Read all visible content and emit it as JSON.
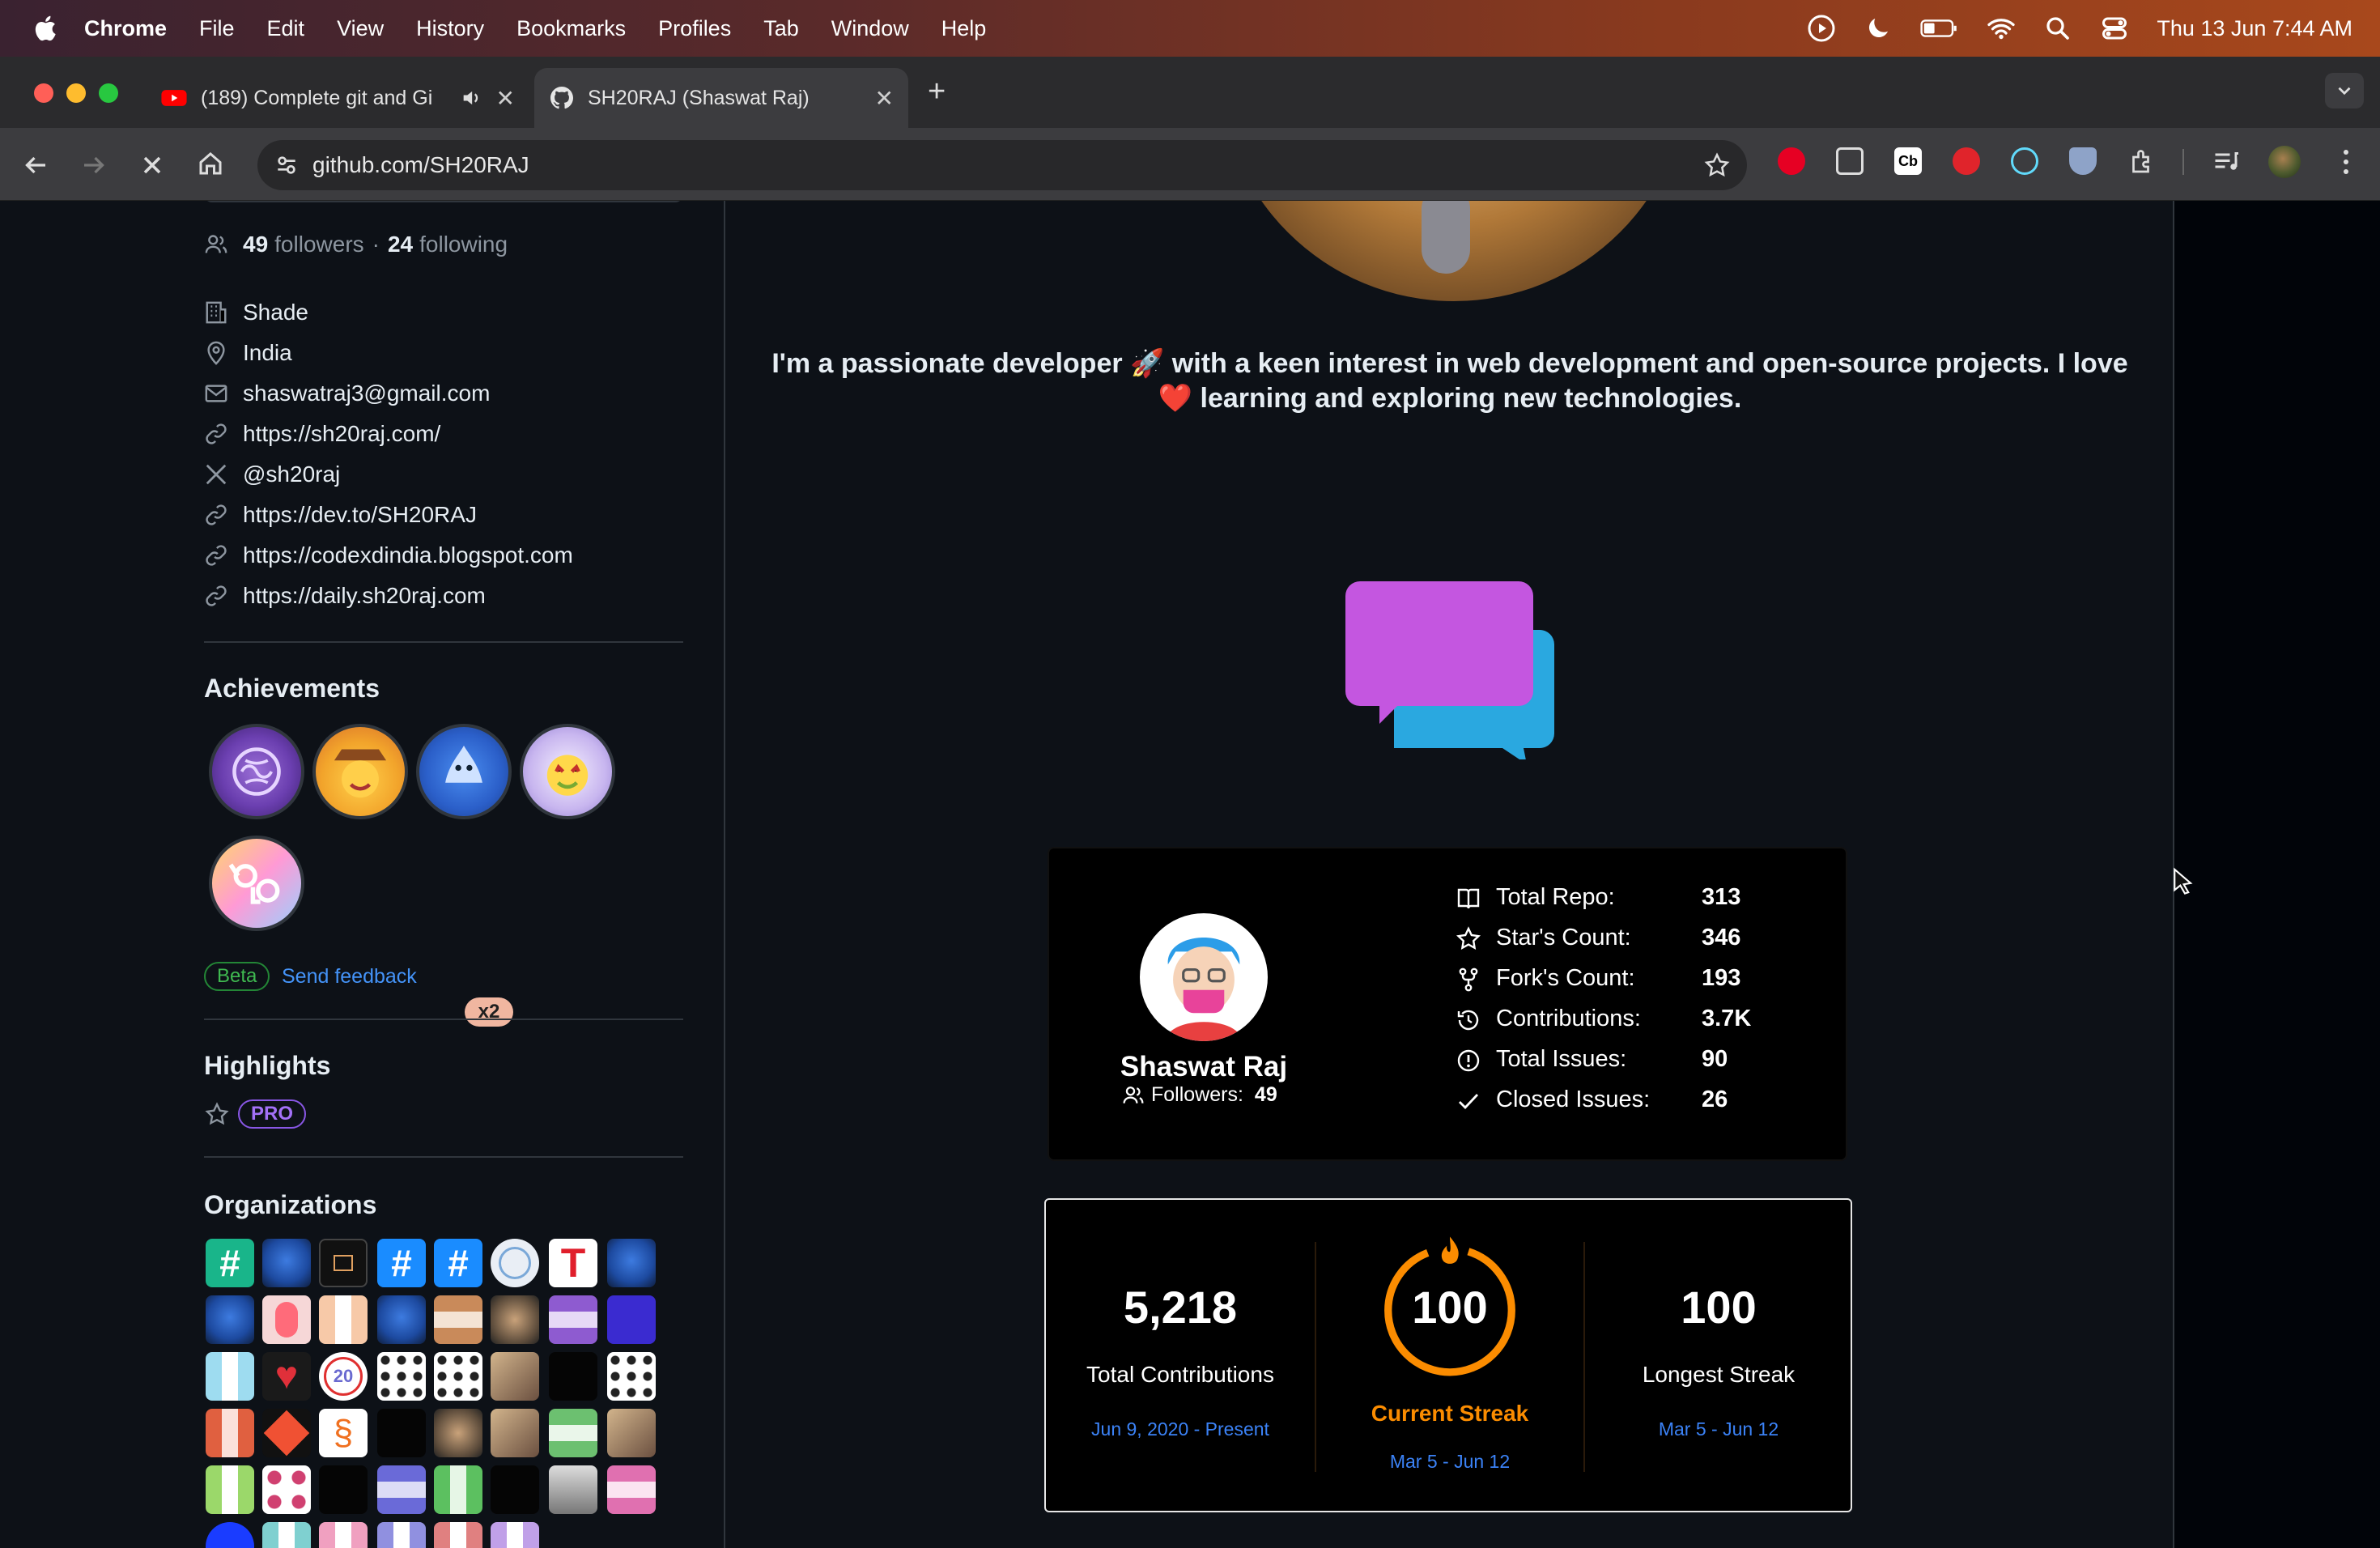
{
  "os_menubar": {
    "app_name": "Chrome",
    "menus": [
      "File",
      "Edit",
      "View",
      "History",
      "Bookmarks",
      "Profiles",
      "Tab",
      "Window",
      "Help"
    ],
    "clock": "Thu 13 Jun  7:44 AM"
  },
  "browser": {
    "tabs": [
      {
        "title": "(189) Complete git and Gi",
        "icon": "youtube-icon"
      },
      {
        "title": "SH20RAJ (Shaswat Raj)",
        "icon": "github-icon"
      }
    ],
    "url": "github.com/SH20RAJ"
  },
  "profile": {
    "followers_count": "49",
    "followers_label": "followers",
    "separator": "·",
    "following_count": "24",
    "following_label": "following",
    "company": "Shade",
    "location": "India",
    "email": "shaswatraj3@gmail.com",
    "website": "https://sh20raj.com/",
    "twitter": "@sh20raj",
    "links": [
      "https://dev.to/SH20RAJ",
      "https://codexdindia.blogspot.com",
      "https://daily.sh20raj.com"
    ],
    "achievements_title": "Achievements",
    "achievement_multiplier": "x2",
    "beta_label": "Beta",
    "feedback_label": "Send feedback",
    "highlights_title": "Highlights",
    "pro_label": "PRO",
    "organizations_title": "Organizations"
  },
  "readme": {
    "bio_line1": "I'm a passionate developer 🚀 with a keen interest in web development and open-source projects. I love",
    "bio_line2": "❤️ learning and exploring new technologies.",
    "stats_card": {
      "name": "Shaswat Raj",
      "followers_label": "Followers:",
      "followers_value": "49",
      "rows": [
        {
          "label": "Total Repo:",
          "value": "313",
          "icon": "repo-icon"
        },
        {
          "label": "Star's Count:",
          "value": "346",
          "icon": "star-icon"
        },
        {
          "label": "Fork's Count:",
          "value": "193",
          "icon": "fork-icon"
        },
        {
          "label": "Contributions:",
          "value": "3.7K",
          "icon": "history-icon"
        },
        {
          "label": "Total Issues:",
          "value": "90",
          "icon": "issue-icon"
        },
        {
          "label": "Closed Issues:",
          "value": "26",
          "icon": "check-icon"
        }
      ]
    },
    "streak_card": {
      "total_value": "5,218",
      "total_label": "Total Contributions",
      "total_range": "Jun 9, 2020 - Present",
      "current_value": "100",
      "current_label": "Current Streak",
      "current_range": "Mar 5 - Jun 12",
      "longest_value": "100",
      "longest_label": "Longest Streak",
      "longest_range": "Mar 5 - Jun 12",
      "accent": "#fb8c00",
      "link_color": "#3b82f6"
    }
  }
}
